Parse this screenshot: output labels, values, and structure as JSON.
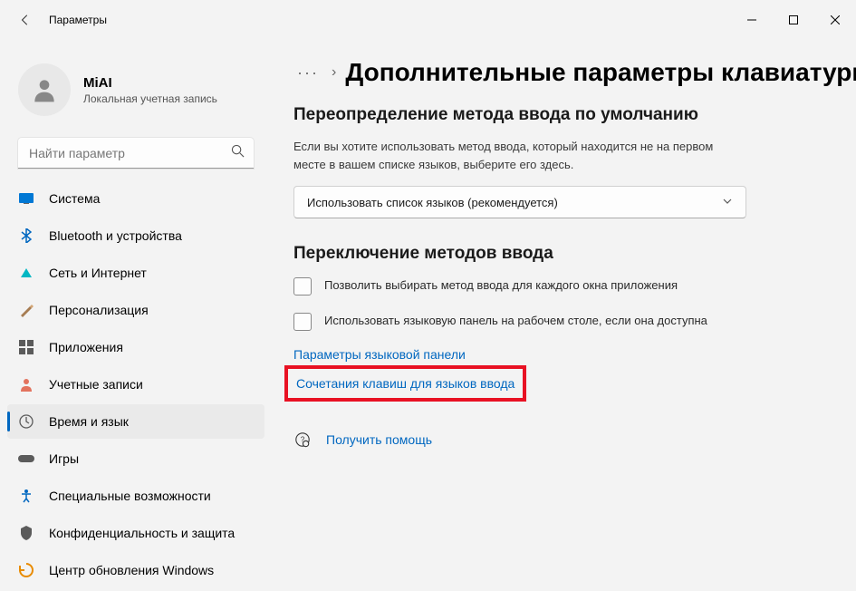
{
  "titlebar": {
    "title": "Параметры"
  },
  "user": {
    "name": "MiAI",
    "account_type": "Локальная учетная запись"
  },
  "search": {
    "placeholder": "Найти параметр"
  },
  "sidebar": {
    "items": [
      {
        "label": "Система",
        "icon": "system",
        "icon_color": "#0078d4"
      },
      {
        "label": "Bluetooth и устройства",
        "icon": "bluetooth",
        "icon_color": "#0067c0"
      },
      {
        "label": "Сеть и Интернет",
        "icon": "network",
        "icon_color": "#00b7c3"
      },
      {
        "label": "Персонализация",
        "icon": "personalization",
        "icon_color": "#8764b8"
      },
      {
        "label": "Приложения",
        "icon": "apps",
        "icon_color": "#5b5b5b"
      },
      {
        "label": "Учетные записи",
        "icon": "accounts",
        "icon_color": "#e3735e"
      },
      {
        "label": "Время и язык",
        "icon": "time-language",
        "icon_color": "#5b5b5b",
        "active": true
      },
      {
        "label": "Игры",
        "icon": "gaming",
        "icon_color": "#5b5b5b"
      },
      {
        "label": "Специальные возможности",
        "icon": "accessibility",
        "icon_color": "#0067c0"
      },
      {
        "label": "Конфиденциальность и защита",
        "icon": "privacy",
        "icon_color": "#5b5b5b"
      },
      {
        "label": "Центр обновления Windows",
        "icon": "update",
        "icon_color": "#e88b00"
      }
    ]
  },
  "main": {
    "page_title": "Дополнительные параметры клавиатуры",
    "section1": {
      "heading": "Переопределение метода ввода по умолчанию",
      "desc": "Если вы хотите использовать метод ввода, который находится не на первом месте в вашем списке языков, выберите его здесь.",
      "dropdown_value": "Использовать список языков (рекомендуется)"
    },
    "section2": {
      "heading": "Переключение методов ввода",
      "checkbox1": "Позволить выбирать метод ввода для каждого окна приложения",
      "checkbox2": "Использовать языковую панель на рабочем столе, если она доступна",
      "link1": "Параметры языковой панели",
      "link2": "Сочетания клавиш для языков ввода"
    },
    "help": {
      "label": "Получить помощь"
    }
  }
}
